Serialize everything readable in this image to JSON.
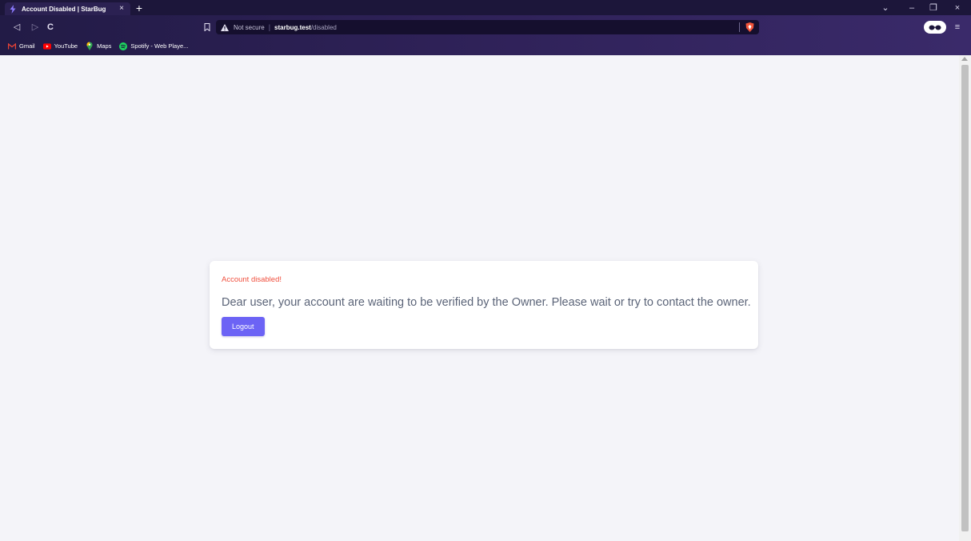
{
  "browser": {
    "tab": {
      "title": "Account Disabled | StarBug",
      "close_glyph": "×",
      "favicon_icon": "starbug-lightning-icon"
    },
    "new_tab_glyph": "+",
    "window_controls": {
      "tab_search": "⌄",
      "minimize": "–",
      "restore": "❐",
      "close": "×"
    },
    "nav": {
      "back": "◁",
      "forward": "▷",
      "reload": "C"
    },
    "address_bar": {
      "security_label": "Not secure",
      "separator": "|",
      "host": "starbug.test",
      "path": "/disabled"
    },
    "menu_glyph": "≡",
    "bookmarks": [
      {
        "label": "Gmail",
        "icon": "gmail-icon"
      },
      {
        "label": "YouTube",
        "icon": "youtube-icon"
      },
      {
        "label": "Maps",
        "icon": "maps-icon"
      },
      {
        "label": "Spotify - Web Playe...",
        "icon": "spotify-icon"
      }
    ]
  },
  "page": {
    "alert_title": "Account disabled!",
    "message": "Dear user, your account are waiting to be verified by the Owner. Please wait or try to contact the owner.",
    "logout_label": "Logout"
  },
  "colors": {
    "accent": "#6c63f5",
    "alert": "#f0503f",
    "message_text": "#5b6478",
    "page_background": "#f4f4f9",
    "chrome_background": "#2e2157"
  }
}
